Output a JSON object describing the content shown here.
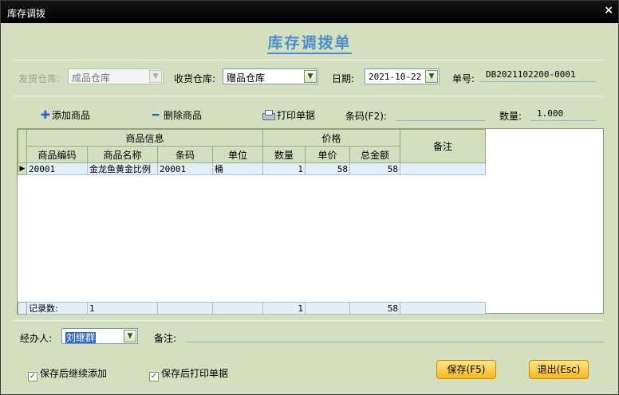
{
  "window": {
    "title": "库存调拨",
    "close": "×"
  },
  "heading": "库存调拨单",
  "form": {
    "from_label": "发货仓库:",
    "from_value": "成品仓库",
    "to_label": "收货仓库:",
    "to_value": "赠品仓库",
    "date_label": "日期:",
    "date_value": "2021-10-22",
    "no_label": "单号:",
    "no_value": "DB2021102200-0001"
  },
  "toolbar": {
    "add": "添加商品",
    "delete": "删除商品",
    "print": "打印单据",
    "barcode_label": "条码(F2):",
    "barcode_value": "",
    "qty_label": "数量:",
    "qty_value": "1.000"
  },
  "table": {
    "group_headers": {
      "product_info": "商品信息",
      "price": "价格",
      "note": "备注"
    },
    "columns": [
      "商品编码",
      "商品名称",
      "条码",
      "单位",
      "数量",
      "单价",
      "总金额"
    ],
    "rows": [
      {
        "code": "20001",
        "name": "金龙鱼黄金比例",
        "barcode": "20001",
        "unit": "桶",
        "qty": "1",
        "price": "58",
        "total": "58",
        "note": ""
      }
    ],
    "footer": {
      "label": "记录数:",
      "count": "1",
      "qty_sum": "1",
      "total_sum": "58"
    }
  },
  "bottom": {
    "handler_label": "经办人:",
    "handler_value": "刘继群",
    "note_label": "备注:",
    "note_value": "",
    "chk_continue": "保存后继续添加",
    "chk_print": "保存后打印单据",
    "save_button": "保存(F5)",
    "exit_button": "退出(Esc)"
  },
  "colors": {
    "background": "#d4dfbf",
    "heading": "#4a8ecb",
    "button": "#f6b81f",
    "selection": "#e2eef8"
  }
}
